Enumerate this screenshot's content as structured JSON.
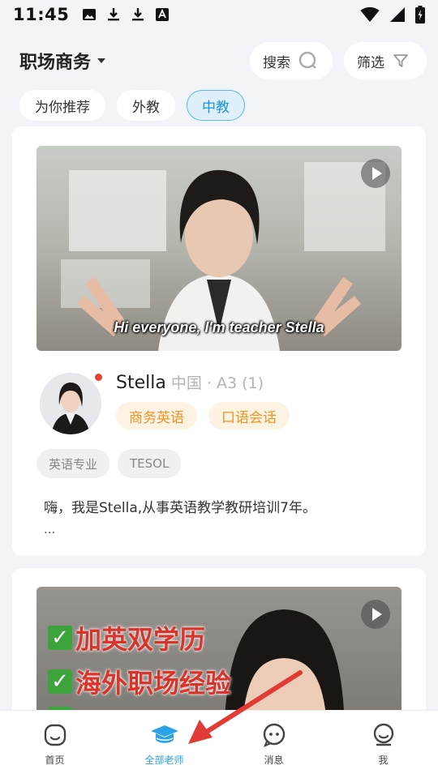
{
  "status_bar": {
    "time": "11:45"
  },
  "header": {
    "title": "职场商务",
    "search_label": "搜索",
    "filter_label": "筛选"
  },
  "tabs": [
    {
      "label": "为你推荐",
      "active": false
    },
    {
      "label": "外教",
      "active": false
    },
    {
      "label": "中教",
      "active": true
    }
  ],
  "cards": [
    {
      "video_caption": "Hi everyone, I'm teacher Stella",
      "teacher_name": "Stella",
      "teacher_meta": "中国 · A3 (1)",
      "skills": [
        "商务英语",
        "口语会话"
      ],
      "certs": [
        "英语专业",
        "TESOL"
      ],
      "intro": "嗨，我是Stella,从事英语教学教研培训7年。",
      "intro_more": "..."
    },
    {
      "video_overlay_lines": [
        "加英双学历",
        "海外职场经验"
      ]
    }
  ],
  "bottom_nav": [
    {
      "label": "首页",
      "icon": "home-icon",
      "active": false
    },
    {
      "label": "全部老师",
      "icon": "teachers-icon",
      "active": true
    },
    {
      "label": "消息",
      "icon": "message-icon",
      "active": false
    },
    {
      "label": "我",
      "icon": "profile-icon",
      "active": false
    }
  ],
  "colors": {
    "accent": "#2aa3e6",
    "skill_tag_text": "#f09422",
    "arrow": "#e23a35"
  }
}
